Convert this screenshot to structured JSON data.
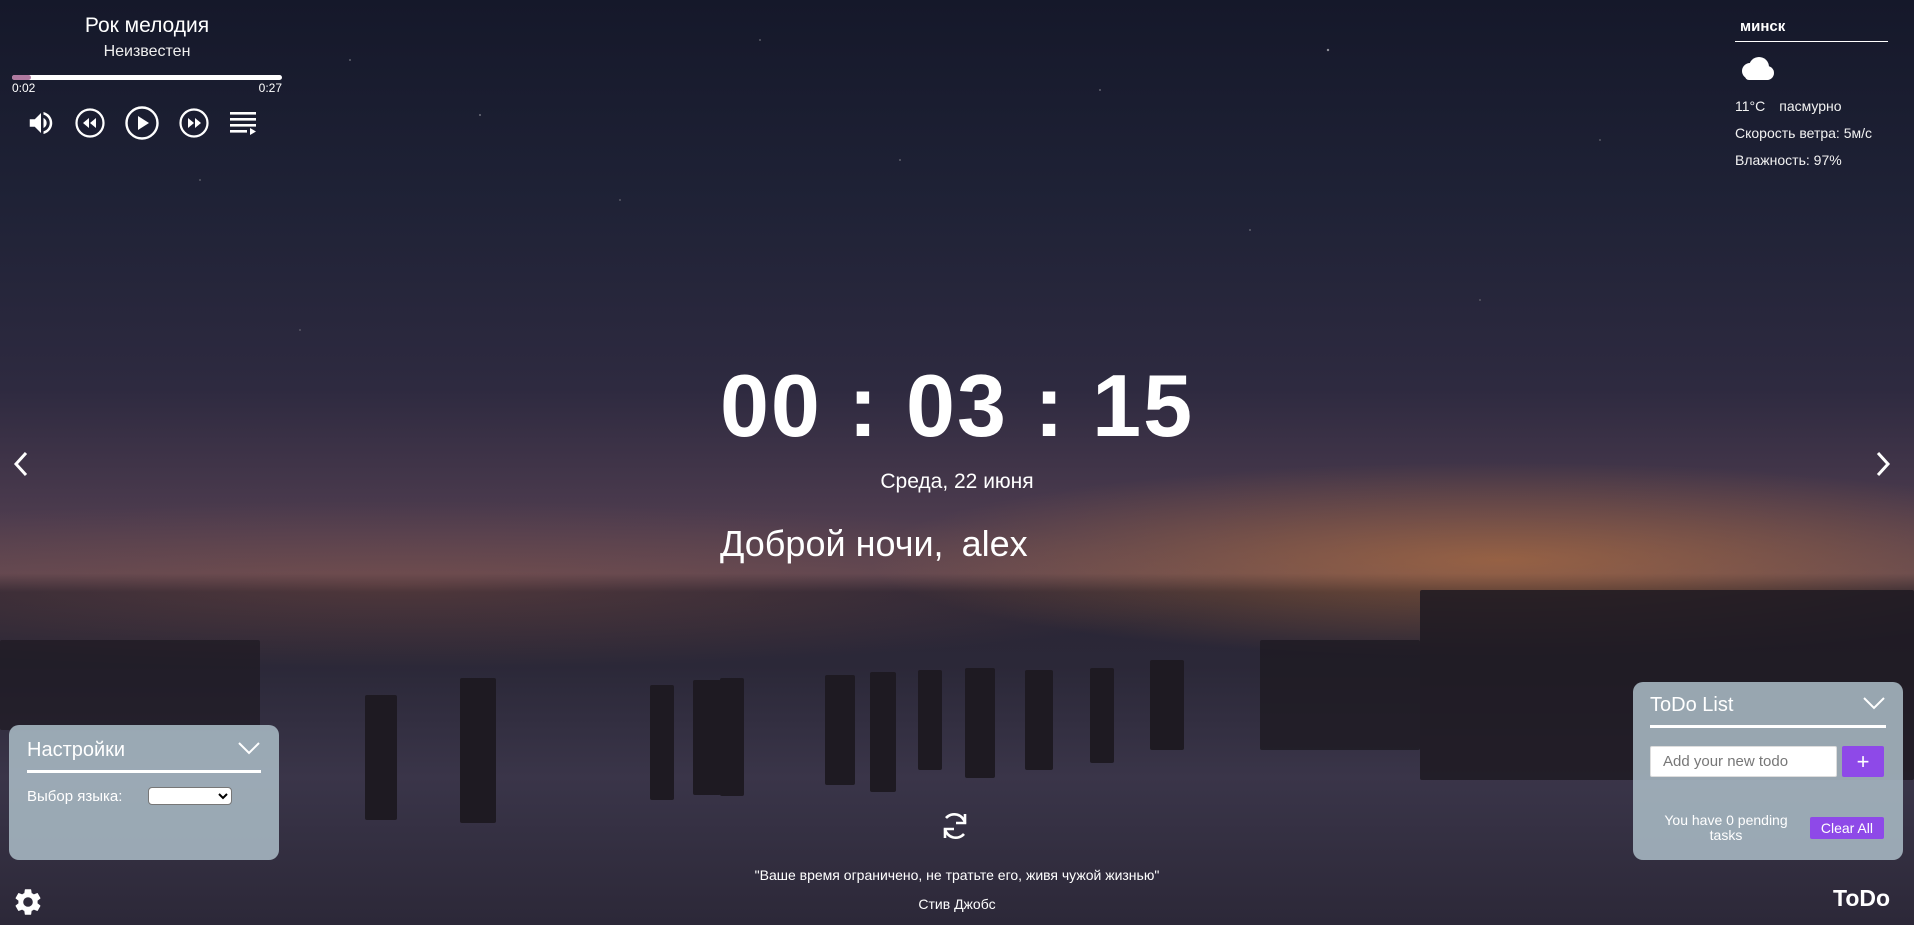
{
  "player": {
    "title": "Рок мелодия",
    "artist": "Неизвестен",
    "current_time": "0:02",
    "duration": "0:27",
    "progress_fraction": 0.07,
    "icons": [
      "volume-icon",
      "rewind-icon",
      "play-icon",
      "fast-forward-icon",
      "playlist-icon"
    ]
  },
  "weather": {
    "city": "минск",
    "icon": "cloud-icon",
    "temperature": "11°C",
    "description": "пасмурно",
    "wind": "Скорость ветра: 5м/с",
    "humidity": "Влажность: 97%"
  },
  "clock": {
    "time": "00 : 03 : 15",
    "date": "Среда, 22 июня"
  },
  "greeting": {
    "text": "Доброй ночи,",
    "name": "alex"
  },
  "quote": {
    "text": "\"Ваше время ограничено, не тратьте его, живя чужой жизнью\"",
    "author": "Стив Джобс"
  },
  "settings": {
    "title": "Настройки",
    "language_label": "Выбор языка:",
    "language_value": ""
  },
  "todo": {
    "title": "ToDo List",
    "input_placeholder": "Add your new todo",
    "add_label": "+",
    "pending_text": "You have 0 pending tasks",
    "clear_label": "Clear All",
    "toggle_label": "ToDo"
  },
  "colors": {
    "accent": "#8e49e8",
    "panel_bg": "#a8b9c4",
    "progress_fill": "#b07aa0"
  }
}
